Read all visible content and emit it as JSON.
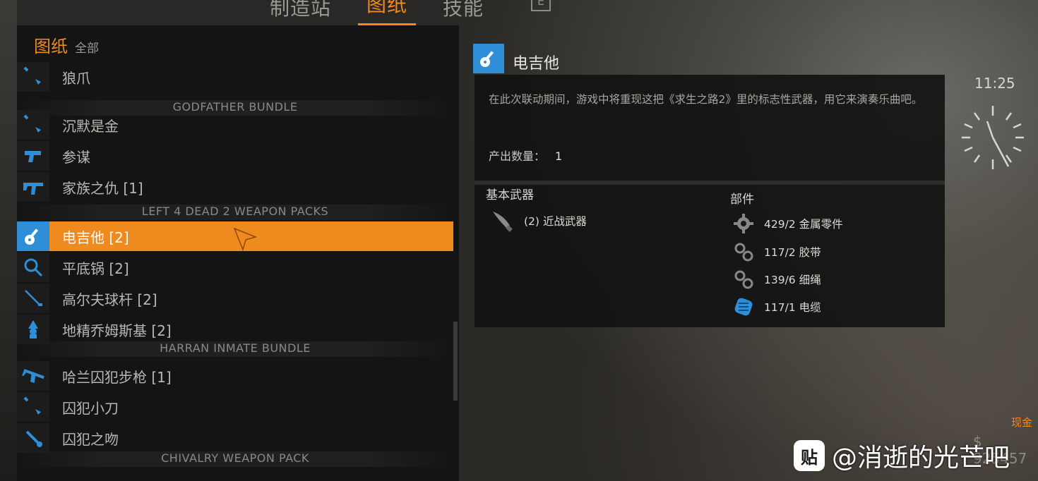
{
  "tabs": [
    {
      "label": "制造站",
      "active": false
    },
    {
      "label": "图纸",
      "active": true
    },
    {
      "label": "技能",
      "active": false
    }
  ],
  "tab_key": "E",
  "list": {
    "title": "图纸",
    "filter": "全部",
    "rows": [
      {
        "kind": "item",
        "label": "狼爪",
        "icon": "knife-icon",
        "selected": false
      },
      {
        "kind": "section",
        "label": "GODFATHER BUNDLE"
      },
      {
        "kind": "item",
        "label": "沉默是金",
        "icon": "knife-icon",
        "selected": false
      },
      {
        "kind": "item",
        "label": "参谋",
        "icon": "pistol-icon",
        "selected": false
      },
      {
        "kind": "item",
        "label": "家族之仇 [1]",
        "icon": "smg-icon",
        "selected": false
      },
      {
        "kind": "section",
        "label": "LEFT 4 DEAD 2 WEAPON PACKS"
      },
      {
        "kind": "item",
        "label": "电吉他 [2]",
        "icon": "guitar-icon",
        "selected": true
      },
      {
        "kind": "item",
        "label": "平底锅 [2]",
        "icon": "pan-icon",
        "selected": false
      },
      {
        "kind": "item",
        "label": "高尔夫球杆 [2]",
        "icon": "golf-club-icon",
        "selected": false
      },
      {
        "kind": "item",
        "label": "地精乔姆斯基 [2]",
        "icon": "gnome-icon",
        "selected": false
      },
      {
        "kind": "section",
        "label": "HARRAN INMATE BUNDLE"
      },
      {
        "kind": "item",
        "label": "哈兰囚犯步枪 [1]",
        "icon": "rifle-icon",
        "selected": false
      },
      {
        "kind": "item",
        "label": "囚犯小刀",
        "icon": "knife-icon",
        "selected": false
      },
      {
        "kind": "item",
        "label": "囚犯之吻",
        "icon": "wrench-icon",
        "selected": false
      },
      {
        "kind": "section",
        "label": "CHIVALRY WEAPON PACK"
      }
    ]
  },
  "detail": {
    "title": "电吉他",
    "description": "在此次联动期间，游戏中将重现这把《求生之路2》里的标志性武器，用它来演奏乐曲吧。",
    "yield_label": "产出数量：",
    "yield_value": "1",
    "base_heading": "基本武器",
    "base_item": "(2) 近战武器",
    "parts_heading": "部件",
    "parts": [
      {
        "label": "429/2 金属零件",
        "icon": "gear-icon"
      },
      {
        "label": "117/2 胶带",
        "icon": "small-gears-icon"
      },
      {
        "label": "139/6 细绳",
        "icon": "small-gears-icon"
      },
      {
        "label": "117/1 电缆",
        "icon": "cable-icon"
      }
    ]
  },
  "time": "11:25",
  "cash_label": "现金",
  "cash_value": "$ 925457",
  "watermark": {
    "logo": "贴",
    "text": "@消逝的光芒吧"
  },
  "colors": {
    "accent": "#ef8a1f",
    "blue": "#2e8fd8"
  }
}
